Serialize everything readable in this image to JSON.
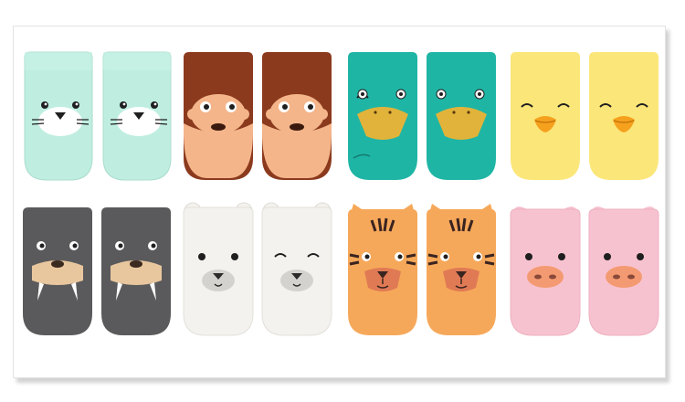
{
  "image": {
    "description_free": true
  },
  "pairs": [
    {
      "animal": "seal",
      "colors": {
        "body": "#bfeee0",
        "face": "#ffffff",
        "nose": "#1f1f1f",
        "accent": "#bfeee0"
      }
    },
    {
      "animal": "monkey",
      "colors": {
        "body": "#8b3a1e",
        "face": "#f4b58a",
        "nose": "#3a1a0f",
        "accent": "#8b3a1e"
      }
    },
    {
      "animal": "platypus",
      "colors": {
        "body": "#1fb5a5",
        "face": "#1fb5a5",
        "nose": "#e2b33a",
        "accent": "#1fb5a5"
      }
    },
    {
      "animal": "duck",
      "colors": {
        "body": "#fbe679",
        "face": "#fbe679",
        "nose": "#f5a11e",
        "accent": "#fbe679"
      }
    },
    {
      "animal": "walrus",
      "colors": {
        "body": "#5a5a5c",
        "face": "#e9c79e",
        "nose": "#3a2a20",
        "accent": "#5a5a5c"
      }
    },
    {
      "animal": "polar-bear",
      "colors": {
        "body": "#f4f2ee",
        "face": "#d3d2cf",
        "nose": "#2b2b2b",
        "accent": "#f4f2ee"
      }
    },
    {
      "animal": "tiger",
      "colors": {
        "body": "#f6a85a",
        "face": "#e07a55",
        "nose": "#3a2420",
        "accent": "#3a2420"
      }
    },
    {
      "animal": "pig",
      "colors": {
        "body": "#f7c2cf",
        "face": "#f49a72",
        "nose": "#8a4a3a",
        "accent": "#f7c2cf"
      }
    }
  ]
}
